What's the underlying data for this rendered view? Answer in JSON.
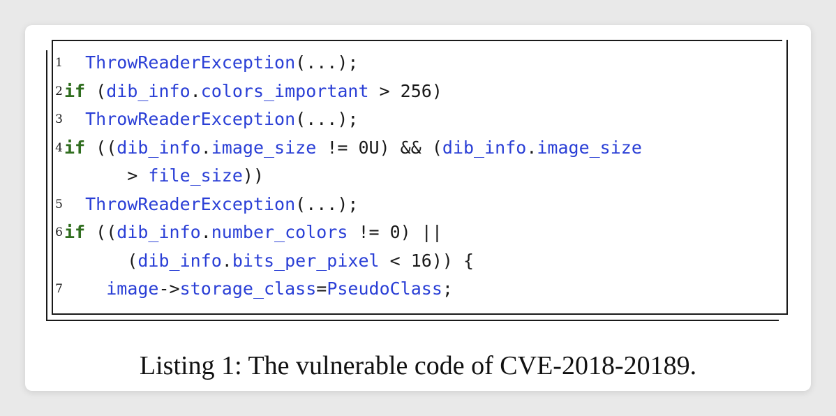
{
  "listing": {
    "lines": [
      {
        "number": "1",
        "tokens": [
          {
            "t": "  ",
            "c": "op"
          },
          {
            "t": "ThrowReaderException",
            "c": "id"
          },
          {
            "t": "(...);",
            "c": "op"
          }
        ]
      },
      {
        "number": "2",
        "tokens": [
          {
            "t": "if",
            "c": "kw"
          },
          {
            "t": " (",
            "c": "op"
          },
          {
            "t": "dib_info",
            "c": "id"
          },
          {
            "t": ".",
            "c": "op"
          },
          {
            "t": "colors_important",
            "c": "id"
          },
          {
            "t": " > 256)",
            "c": "op"
          }
        ]
      },
      {
        "number": "3",
        "tokens": [
          {
            "t": "  ",
            "c": "op"
          },
          {
            "t": "ThrowReaderException",
            "c": "id"
          },
          {
            "t": "(...);",
            "c": "op"
          }
        ]
      },
      {
        "number": "4",
        "tokens": [
          {
            "t": "if",
            "c": "kw"
          },
          {
            "t": " ((",
            "c": "op"
          },
          {
            "t": "dib_info",
            "c": "id"
          },
          {
            "t": ".",
            "c": "op"
          },
          {
            "t": "image_size",
            "c": "id"
          },
          {
            "t": " != 0U) && (",
            "c": "op"
          },
          {
            "t": "dib_info",
            "c": "id"
          },
          {
            "t": ".",
            "c": "op"
          },
          {
            "t": "image_size",
            "c": "id"
          }
        ]
      },
      {
        "number": "",
        "tokens": [
          {
            "t": "      > ",
            "c": "op"
          },
          {
            "t": "file_size",
            "c": "id"
          },
          {
            "t": "))",
            "c": "op"
          }
        ]
      },
      {
        "number": "5",
        "tokens": [
          {
            "t": "  ",
            "c": "op"
          },
          {
            "t": "ThrowReaderException",
            "c": "id"
          },
          {
            "t": "(...);",
            "c": "op"
          }
        ]
      },
      {
        "number": "6",
        "tokens": [
          {
            "t": "if",
            "c": "kw"
          },
          {
            "t": " ((",
            "c": "op"
          },
          {
            "t": "dib_info",
            "c": "id"
          },
          {
            "t": ".",
            "c": "op"
          },
          {
            "t": "number_colors",
            "c": "id"
          },
          {
            "t": " != 0) ||",
            "c": "op"
          }
        ]
      },
      {
        "number": "",
        "tokens": [
          {
            "t": "      (",
            "c": "op"
          },
          {
            "t": "dib_info",
            "c": "id"
          },
          {
            "t": ".",
            "c": "op"
          },
          {
            "t": "bits_per_pixel",
            "c": "id"
          },
          {
            "t": " < 16)) {",
            "c": "op"
          }
        ]
      },
      {
        "number": "7",
        "tokens": [
          {
            "t": "    ",
            "c": "op"
          },
          {
            "t": "image",
            "c": "id"
          },
          {
            "t": "->",
            "c": "op"
          },
          {
            "t": "storage_class",
            "c": "id"
          },
          {
            "t": "=",
            "c": "op"
          },
          {
            "t": "PseudoClass",
            "c": "id"
          },
          {
            "t": ";",
            "c": "op"
          }
        ]
      }
    ]
  },
  "caption": "Listing 1: The vulnerable code of CVE-2018-20189.",
  "colors": {
    "keyword": "#2f6d1e",
    "identifier": "#2a3fd6",
    "text": "#1a1a1a"
  }
}
